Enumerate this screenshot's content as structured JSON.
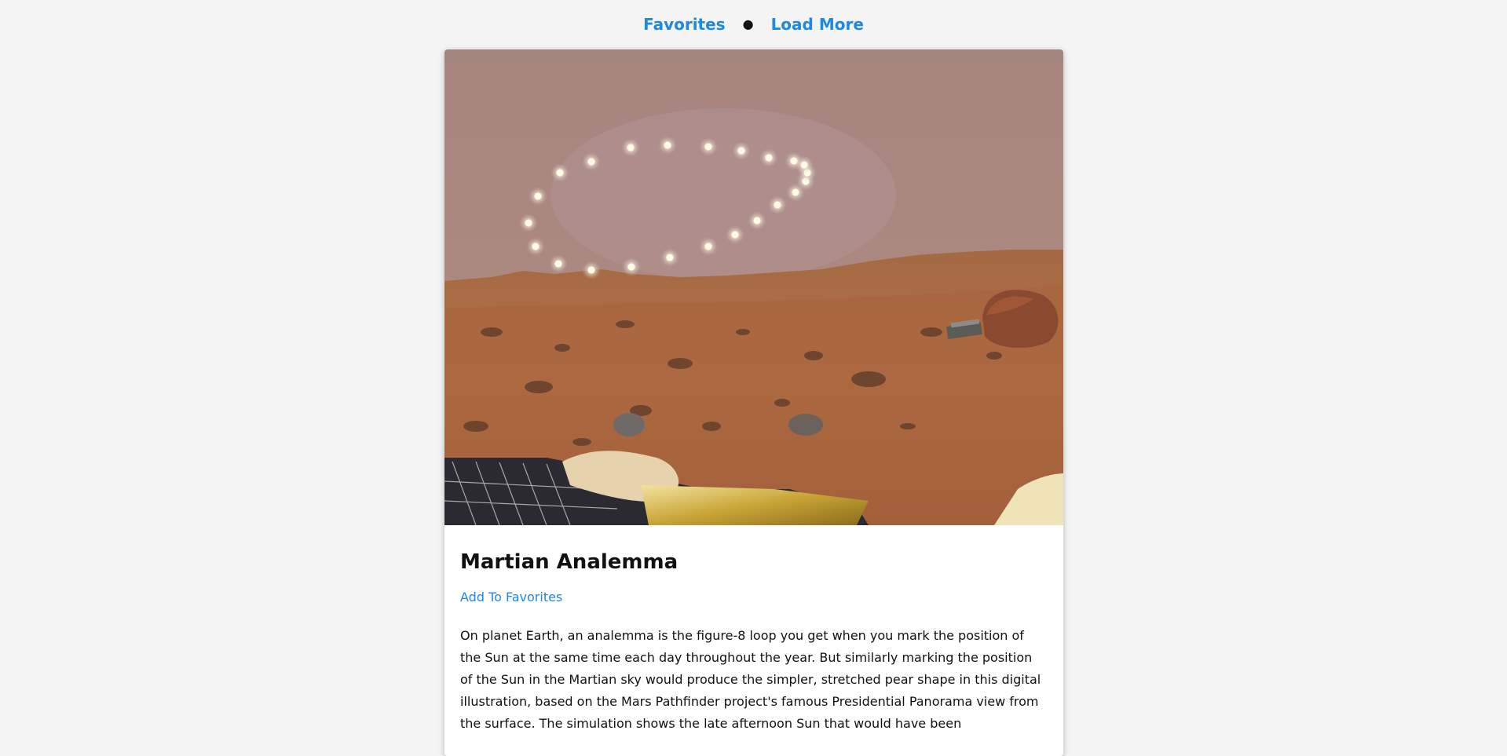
{
  "nav": {
    "favorites_label": "Favorites",
    "separator": "●",
    "load_more_label": "Load More"
  },
  "post": {
    "title": "Martian Analemma",
    "add_favorite_label": "Add To Favorites",
    "explanation": "On planet Earth, an analemma is the figure-8 loop you get when you mark the position of the Sun at the same time each day throughout the year. But similarly marking the position of the Sun in the Martian sky would produce the simpler, stretched pear shape in this digital illustration, based on the Mars Pathfinder project's famous Presidential Panorama view from the surface. The simulation shows the late afternoon Sun that would have been"
  },
  "colors": {
    "accent": "#1e88e5",
    "page_background": "#f4f4f4",
    "card_background": "#ffffff"
  }
}
